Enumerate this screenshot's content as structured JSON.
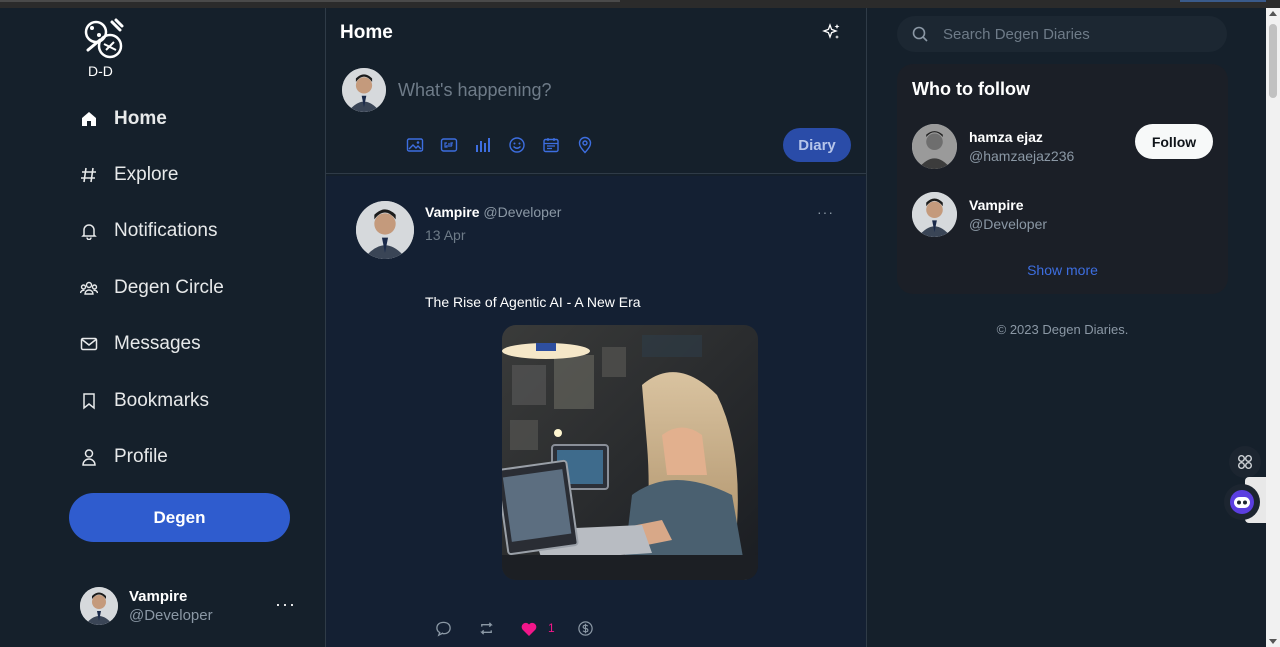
{
  "brand": {
    "logo_text": "D-D"
  },
  "nav": {
    "items": [
      {
        "label": "Home",
        "icon": "home-icon"
      },
      {
        "label": "Explore",
        "icon": "hash-icon"
      },
      {
        "label": "Notifications",
        "icon": "bell-icon"
      },
      {
        "label": "Degen Circle",
        "icon": "circle-users-icon"
      },
      {
        "label": "Messages",
        "icon": "mail-icon"
      },
      {
        "label": "Bookmarks",
        "icon": "bookmark-icon"
      },
      {
        "label": "Profile",
        "icon": "user-icon"
      }
    ],
    "cta_label": "Degen"
  },
  "current_user": {
    "name": "Vampire",
    "handle": "@Developer",
    "more": "···"
  },
  "main": {
    "title": "Home",
    "composer": {
      "placeholder": "What's happening?",
      "submit_label": "Diary",
      "tools": [
        "image-icon",
        "gif-icon",
        "poll-icon",
        "emoji-icon",
        "calendar-icon",
        "location-icon"
      ]
    },
    "post": {
      "author_name": "Vampire",
      "author_handle": "@Developer",
      "date": "13 Apr",
      "more": "···",
      "text": "The Rise of Agentic AI - A New Era",
      "like_count": "1"
    }
  },
  "right": {
    "search_placeholder": "Search Degen Diaries",
    "who_to_follow": {
      "title": "Who to follow",
      "users": [
        {
          "name": "hamza ejaz",
          "handle": "@hamzaejaz236"
        },
        {
          "name": "Vampire",
          "handle": "@Developer"
        }
      ],
      "follow_label": "Follow",
      "show_more": "Show more"
    },
    "copyright": "© 2023 Degen Diaries."
  },
  "colors": {
    "background": "#15202b",
    "accent": "#2f5cce",
    "like": "#f2168a"
  }
}
